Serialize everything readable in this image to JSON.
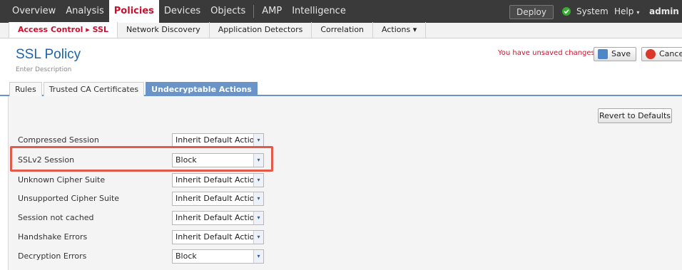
{
  "topnav": {
    "items": [
      "Overview",
      "Analysis",
      "Policies",
      "Devices",
      "Objects"
    ],
    "items_right": [
      "AMP",
      "Intelligence"
    ],
    "deploy": "Deploy",
    "system": "System",
    "help": "Help",
    "user": "admin",
    "caret": "▾"
  },
  "subnav": {
    "active": "Access Control ▸ SSL",
    "items": [
      "Network Discovery",
      "Application Detectors",
      "Correlation",
      "Actions ▾"
    ]
  },
  "header": {
    "title": "SSL Policy",
    "description_placeholder": "Enter Description",
    "unsaved": "You have unsaved changes",
    "save": "Save",
    "cancel": "Cancel"
  },
  "tabs": [
    "Rules",
    "Trusted CA Certificates",
    "Undecryptable Actions"
  ],
  "revert": "Revert to Defaults",
  "rows": [
    {
      "label": "Compressed Session",
      "value": "Inherit Default Action"
    },
    {
      "label": "SSLv2 Session",
      "value": "Block"
    },
    {
      "label": "Unknown Cipher Suite",
      "value": "Inherit Default Action"
    },
    {
      "label": "Unsupported Cipher Suite",
      "value": "Inherit Default Action"
    },
    {
      "label": "Session not cached",
      "value": "Inherit Default Action"
    },
    {
      "label": "Handshake Errors",
      "value": "Inherit Default Action"
    },
    {
      "label": "Decryption Errors",
      "value": "Block"
    }
  ],
  "colors": {
    "accent": "#c8102e",
    "tab_active": "#6a93c7",
    "title": "#1c64a8",
    "highlight": "#e35a4a"
  }
}
